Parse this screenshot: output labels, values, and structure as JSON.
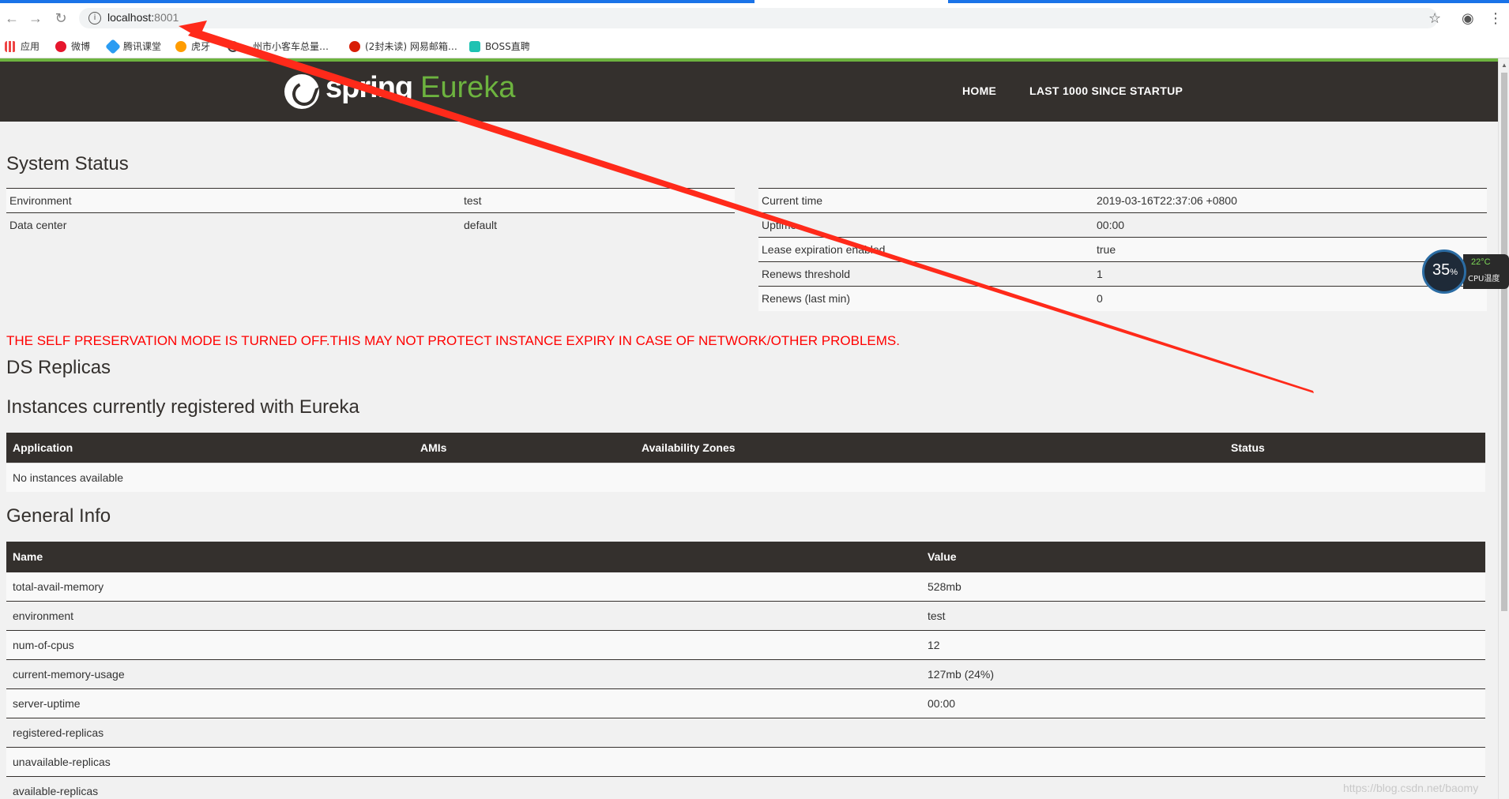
{
  "browser": {
    "url_host": "localhost:",
    "url_port": "8001",
    "bookmarks": [
      "应用",
      "微博",
      "腾讯课堂",
      "虎牙",
      "…州市小客车总量…",
      "(2封未读) 网易邮箱…",
      "BOSS直聘"
    ]
  },
  "nav": {
    "logo_spring": "spring",
    "logo_eureka": "Eureka",
    "home": "HOME",
    "last1000": "LAST 1000 SINCE STARTUP"
  },
  "system_status": {
    "title": "System Status",
    "left": [
      {
        "k": "Environment",
        "v": "test"
      },
      {
        "k": "Data center",
        "v": "default"
      }
    ],
    "right": [
      {
        "k": "Current time",
        "v": "2019-03-16T22:37:06 +0800"
      },
      {
        "k": "Uptime",
        "v": "00:00"
      },
      {
        "k": "Lease expiration enabled",
        "v": "true"
      },
      {
        "k": "Renews threshold",
        "v": "1"
      },
      {
        "k": "Renews (last min)",
        "v": "0"
      }
    ]
  },
  "warning": "THE SELF PRESERVATION MODE IS TURNED OFF.THIS MAY NOT PROTECT INSTANCE EXPIRY IN CASE OF NETWORK/OTHER PROBLEMS.",
  "ds_replicas_title": "DS Replicas",
  "instances": {
    "title": "Instances currently registered with Eureka",
    "headers": [
      "Application",
      "AMIs",
      "Availability Zones",
      "Status"
    ],
    "empty": "No instances available"
  },
  "general_info": {
    "title": "General Info",
    "headers": [
      "Name",
      "Value"
    ],
    "rows": [
      {
        "k": "total-avail-memory",
        "v": "528mb"
      },
      {
        "k": "environment",
        "v": "test"
      },
      {
        "k": "num-of-cpus",
        "v": "12"
      },
      {
        "k": "current-memory-usage",
        "v": "127mb (24%)"
      },
      {
        "k": "server-uptime",
        "v": "00:00"
      },
      {
        "k": "registered-replicas",
        "v": ""
      },
      {
        "k": "unavailable-replicas",
        "v": ""
      },
      {
        "k": "available-replicas",
        "v": ""
      }
    ]
  },
  "cpu_widget": {
    "percent": "35",
    "percent_sign": "%",
    "temp": "22°C",
    "label": "CPU温度"
  },
  "watermark": "https://blog.csdn.net/baomy",
  "colors": {
    "brand_green": "#6db33f",
    "nav_dark": "#34302d",
    "warning_red": "#ff0000",
    "annotation_red": "#ff2a1a"
  }
}
